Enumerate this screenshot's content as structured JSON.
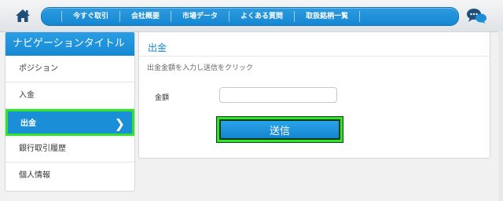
{
  "header": {
    "home_icon": "home-icon",
    "nav": [
      {
        "label": "今すぐ取引"
      },
      {
        "label": "会社概要"
      },
      {
        "label": "市場データ"
      },
      {
        "label": "よくある質問"
      },
      {
        "label": "取扱銘柄一覧"
      }
    ],
    "chat_icon": "chat-bubbles-icon"
  },
  "sidebar": {
    "title": "ナビゲーションタイトル",
    "items": [
      {
        "label": "ポジション",
        "active": false
      },
      {
        "label": "入金",
        "active": false
      },
      {
        "label": "出金",
        "active": true
      },
      {
        "label": "銀行取引履歴",
        "active": false
      },
      {
        "label": "個人情報",
        "active": false
      }
    ],
    "active_chevron": "❯"
  },
  "main": {
    "title": "出金",
    "instruction": "出金金額を入力し送信をクリック",
    "amount_label": "金額",
    "amount_value": "",
    "submit_label": "送信"
  },
  "colors": {
    "accent_blue": "#1a8fd8",
    "highlight_green": "#2ee52a",
    "title_blue": "#1a86cf"
  }
}
